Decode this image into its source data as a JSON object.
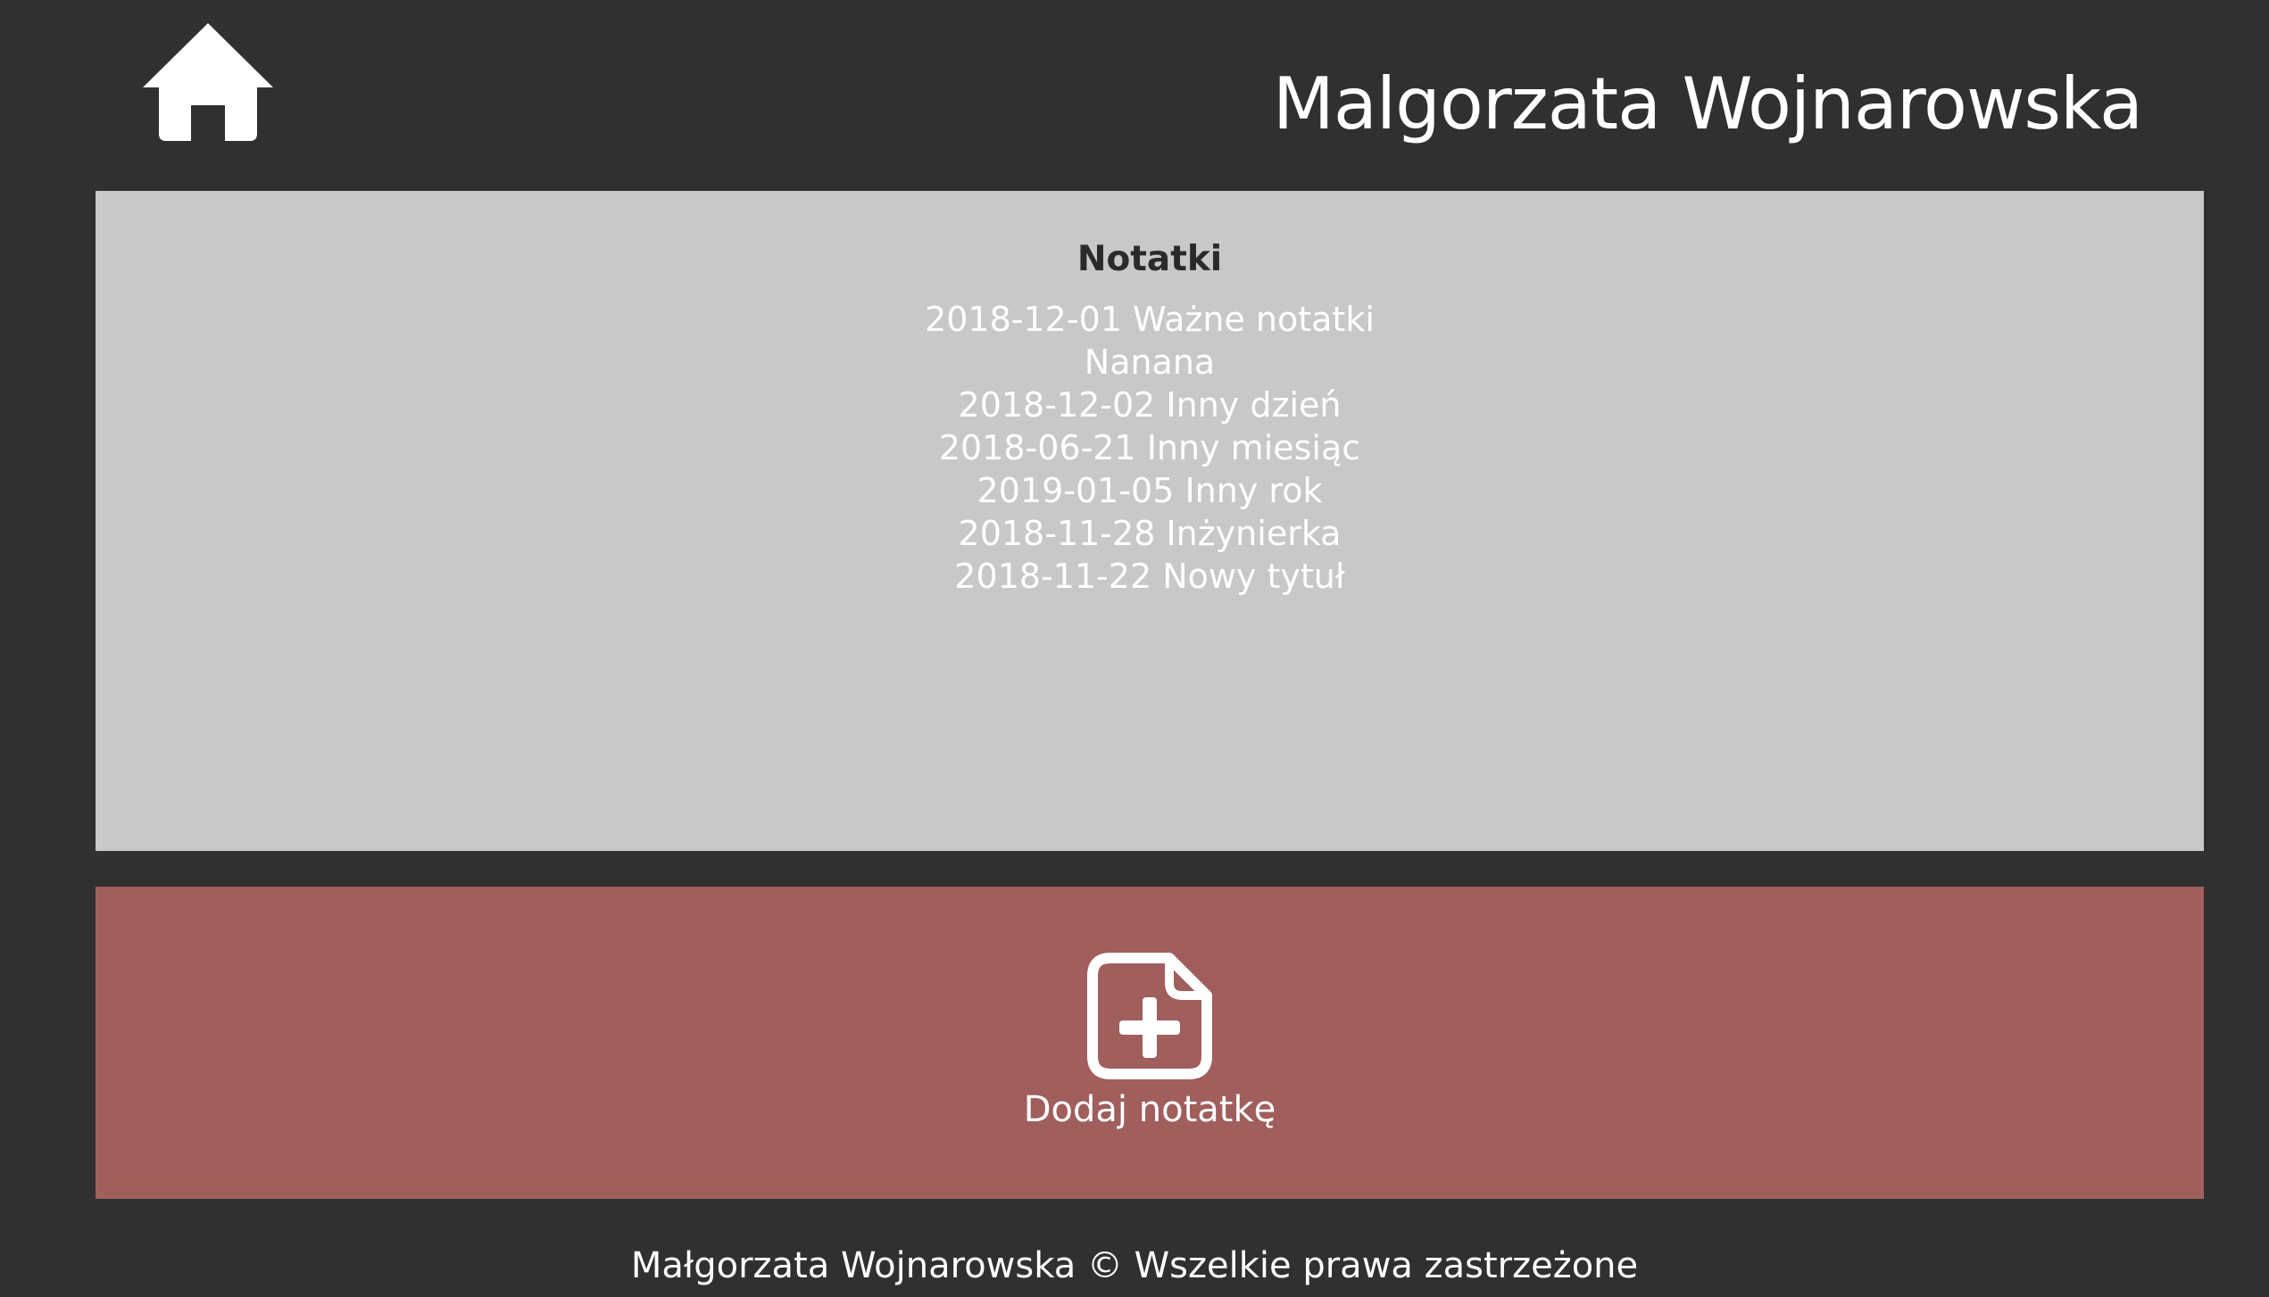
{
  "header": {
    "home_icon": "home-icon",
    "title": "Malgorzata Wojnarowska"
  },
  "notes": {
    "heading": "Notatki",
    "items": [
      "2018-12-01 Ważne notatki",
      "Nanana",
      "2018-12-02 Inny dzień",
      "2018-06-21 Inny miesiąc",
      "2019-01-05 Inny rok",
      "2018-11-28 Inżynierka",
      "2018-11-22 Nowy tytuł"
    ]
  },
  "add_note": {
    "icon": "file-plus-icon",
    "label": "Dodaj notatkę"
  },
  "footer": {
    "text": "Małgorzata Wojnarowska © Wszelkie prawa zastrzeżone"
  },
  "colors": {
    "background": "#303030",
    "notes_panel": "#c8c8c8",
    "add_panel": "#a05e5c",
    "text": "#ffffff",
    "heading_text": "#2a2a2a"
  }
}
